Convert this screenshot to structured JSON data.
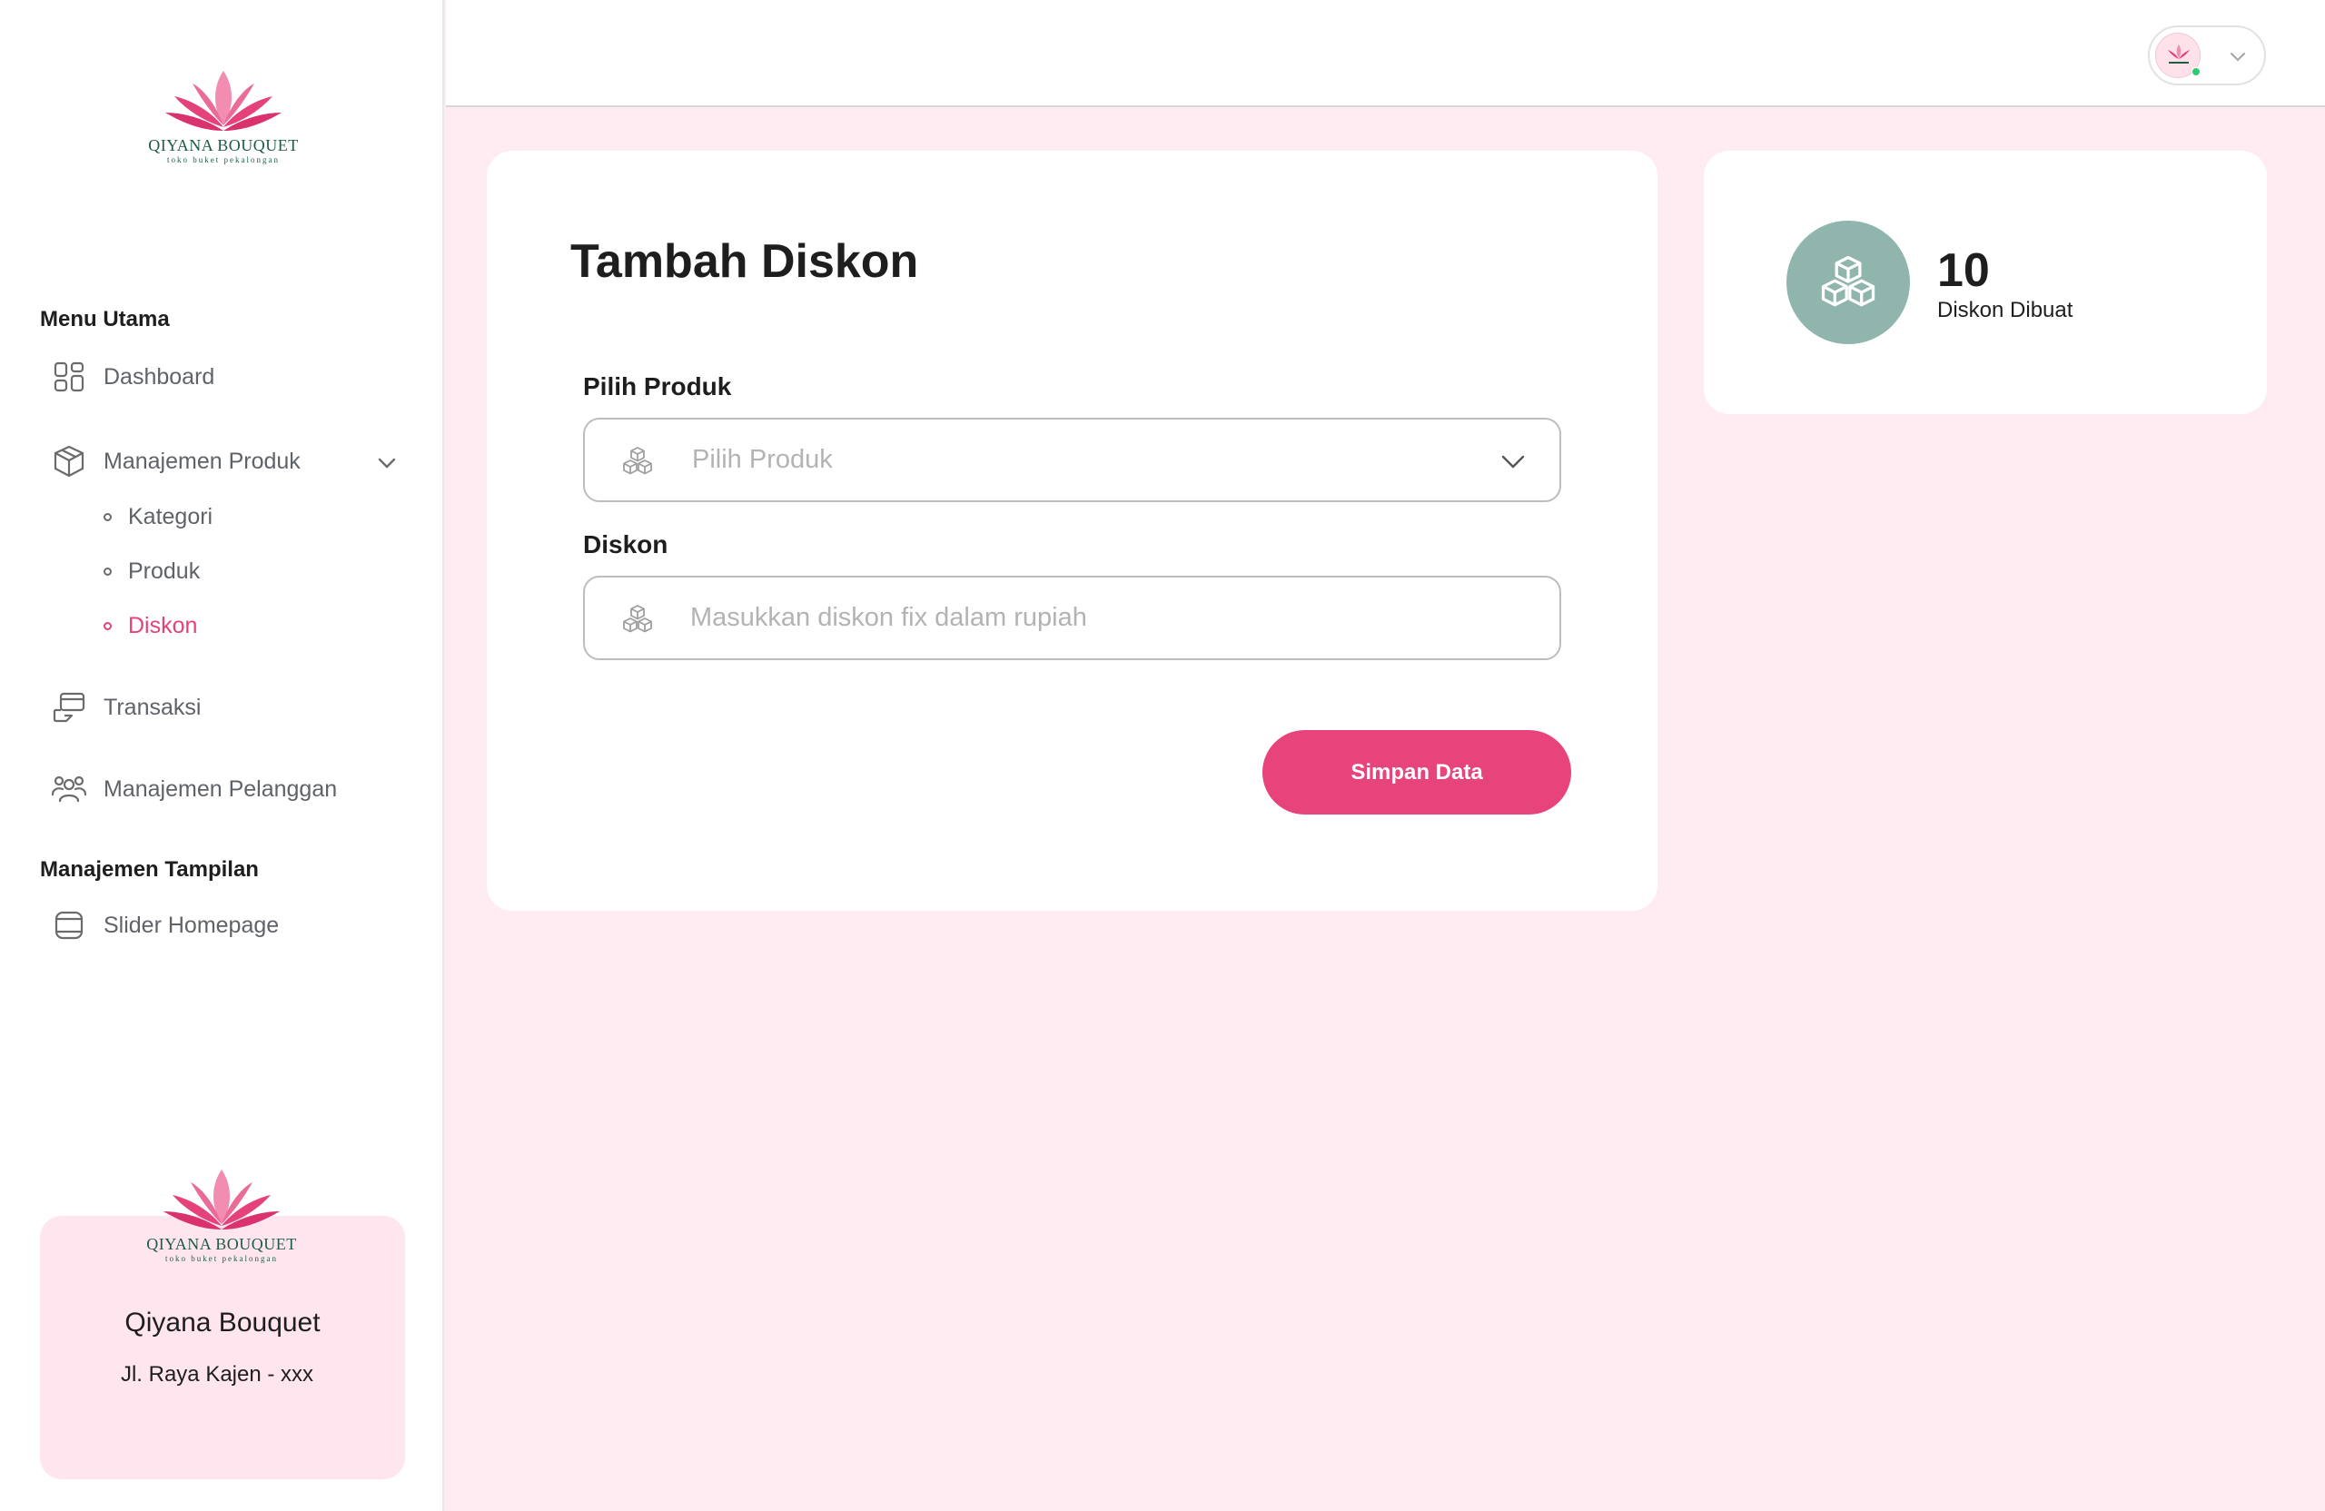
{
  "brand": {
    "name": "QIYANA BOUQUET",
    "tagline": "toko buket pekalongan"
  },
  "sidebar": {
    "section_main": "Menu Utama",
    "items": [
      {
        "label": "Dashboard",
        "icon": "grid-icon"
      },
      {
        "label": "Manajemen Produk",
        "icon": "box-icon",
        "expanded": true,
        "children": [
          {
            "label": "Kategori",
            "active": false
          },
          {
            "label": "Produk",
            "active": false
          },
          {
            "label": "Diskon",
            "active": true
          }
        ]
      },
      {
        "label": "Transaksi",
        "icon": "transaction-icon"
      },
      {
        "label": "Manajemen Pelanggan",
        "icon": "users-icon"
      }
    ],
    "section_display": "Manajemen Tampilan",
    "display_items": [
      {
        "label": "Slider Homepage",
        "icon": "slider-icon"
      }
    ],
    "store": {
      "name": "Qiyana Bouquet",
      "address": "Jl. Raya Kajen - xxx"
    }
  },
  "header": {
    "profile_status": "online"
  },
  "form": {
    "title": "Tambah Diskon",
    "product_label": "Pilih Produk",
    "product_placeholder": "Pilih Produk",
    "discount_label": "Diskon",
    "discount_placeholder": "Masukkan diskon fix dalam rupiah",
    "submit_label": "Simpan Data"
  },
  "stats": {
    "value": "10",
    "label": "Diskon Dibuat"
  },
  "colors": {
    "accent": "#e6447a",
    "background": "#ffecf2",
    "stat_icon_bg": "#8fb5ad",
    "online": "#2ecc71"
  }
}
